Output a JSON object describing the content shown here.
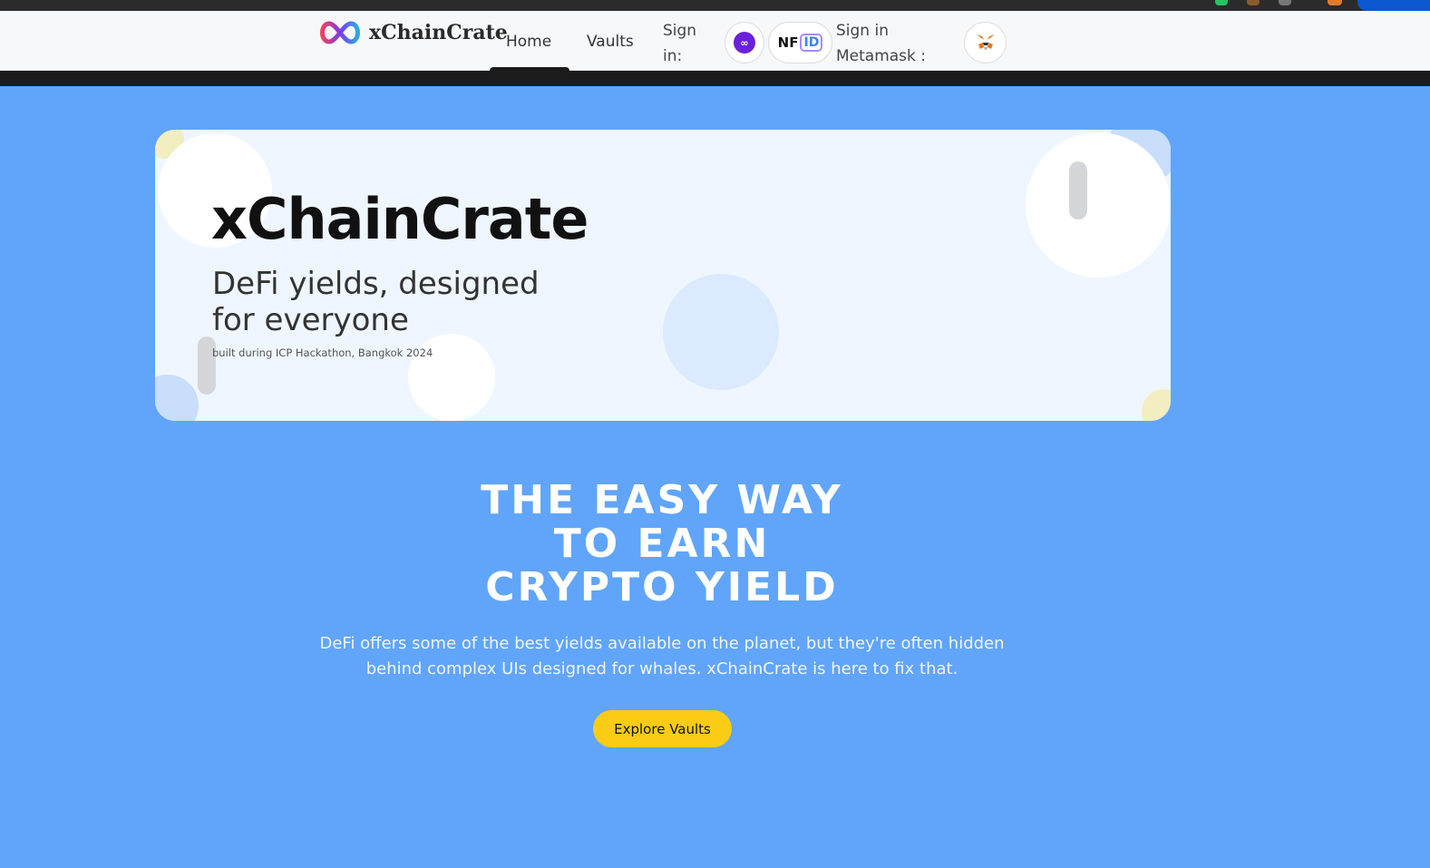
{
  "colors": {
    "page_background": "#60a5fa",
    "hero_card": "#eff6ff",
    "accent_button": "#facc15",
    "navbar": "#f7f8fa"
  },
  "navbar": {
    "brand": "xChainCrate",
    "links": [
      {
        "label": "Home",
        "active": true
      },
      {
        "label": "Vaults",
        "active": false
      }
    ],
    "signin_label": "Sign in:",
    "nfid_nf": "NF",
    "nfid_id": "ID",
    "metamask_label": "Sign in Metamask :",
    "icons": [
      "infinity-logo-icon",
      "internet-identity-icon",
      "nfid-icon",
      "metamask-fox-icon"
    ]
  },
  "hero": {
    "title": "xChainCrate",
    "subtitle": "DeFi yields, designed for everyone",
    "note": "built during ICP Hackathon, Bangkok 2024"
  },
  "main": {
    "headline_line1": "THE EASY WAY",
    "headline_line2": "TO EARN",
    "headline_line3": "CRYPTO YIELD",
    "description": "DeFi offers some of the best yields available on the planet, but they're often hidden behind complex UIs designed for whales. xChainCrate is here to fix that.",
    "cta_label": "Explore Vaults"
  }
}
